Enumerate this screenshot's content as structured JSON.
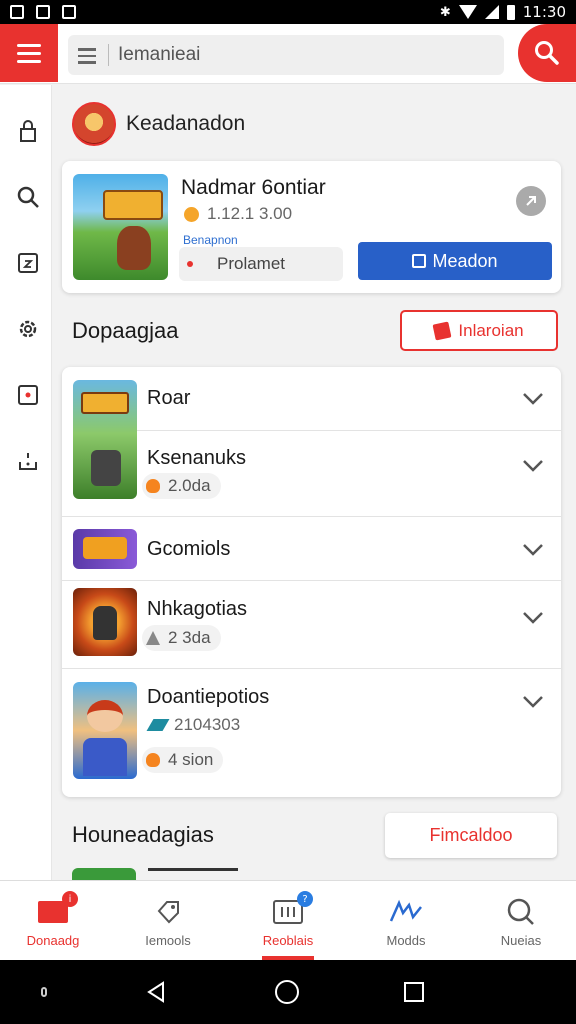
{
  "status_bar": {
    "time": "11:30"
  },
  "search": {
    "placeholder": "",
    "value": "Iemanieai"
  },
  "header": {
    "title": "Keadanadon"
  },
  "featured": {
    "title": "Nadmar 6ontiar",
    "rating": "1.12.1 3.00",
    "subtitle": "Benapnon",
    "pill_label": "Prolamet",
    "button_label": "Meadon"
  },
  "section2": {
    "title": "Dopaagjaa",
    "button_label": "Inlaroian"
  },
  "list": [
    {
      "title": "Roar",
      "chip": ""
    },
    {
      "title": "Ksenanuks",
      "chip": "2.0da"
    },
    {
      "title": "Gcomiols",
      "chip": ""
    },
    {
      "title": "Nhkagotias",
      "chip": "2 3da"
    },
    {
      "title": "Doantiepotios",
      "meta": "2104303",
      "chip": "4 sion"
    }
  ],
  "section3": {
    "title": "Houneadagias",
    "button_label": "Fimcaldoo"
  },
  "bottom_nav": [
    {
      "label": "Donaadg",
      "badge": "i"
    },
    {
      "label": "Iemools",
      "badge": ""
    },
    {
      "label": "Reoblais",
      "badge": "?"
    },
    {
      "label": "Modds",
      "badge": ""
    },
    {
      "label": "Nueias",
      "badge": ""
    }
  ],
  "colors": {
    "accent": "#e8322f",
    "primary_button": "#2860c8",
    "badge_blue": "#2a7de1"
  }
}
